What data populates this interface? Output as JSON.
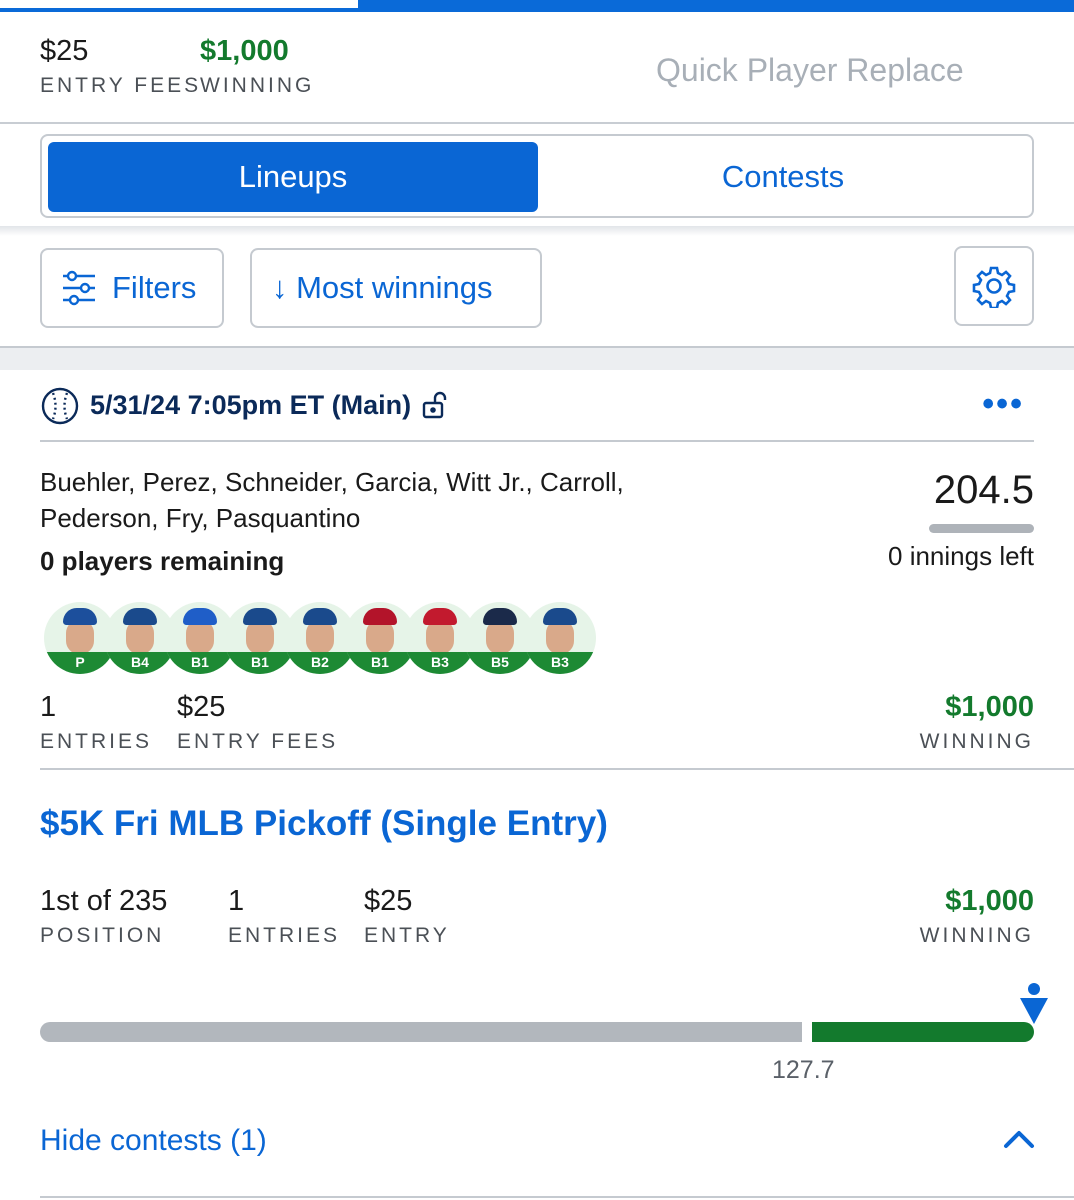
{
  "summary": {
    "entry_fees_value": "$25",
    "entry_fees_label": "ENTRY FEES",
    "winning_value": "$1,000",
    "winning_label": "WINNING",
    "quick_replace": "Quick Player Replace"
  },
  "tabs": {
    "lineups": "Lineups",
    "contests": "Contests",
    "active": "Lineups"
  },
  "toolbar": {
    "filters_label": "Filters",
    "sort_label": "↓ Most winnings",
    "settings_icon": "gear-icon",
    "filters_icon": "sliders-icon"
  },
  "lineup": {
    "date": "5/31/24 7:05pm ET (Main)",
    "sport_icon": "baseball-icon",
    "lock_icon": "unlocked-icon",
    "menu": "•••",
    "players": "Buehler, Perez, Schneider, Garcia, Witt Jr., Carroll, Pederson, Fry, Pasquantino",
    "remaining": "0 players remaining",
    "score": "204.5",
    "innings_left": "0 innings left",
    "positions": [
      "P",
      "B4",
      "B1",
      "B1",
      "B2",
      "B1",
      "B3",
      "B5",
      "B3"
    ],
    "cap_colors": [
      "#1c4f9c",
      "#1a4a8c",
      "#1f5ec8",
      "#1a4a8c",
      "#1a4a8c",
      "#b3142a",
      "#c21a2e",
      "#1b2a4a",
      "#1a4a8c"
    ],
    "entries_value": "1",
    "entries_label": "ENTRIES",
    "fees_value": "$25",
    "fees_label": "ENTRY FEES",
    "winning_value": "$1,000",
    "winning_label": "WINNING"
  },
  "contest": {
    "title": "$5K Fri MLB Pickoff (Single Entry)",
    "position_value": "1st of 235",
    "position_label": "POSITION",
    "entries_value": "1",
    "entries_label": "ENTRIES",
    "entry_value": "$25",
    "entry_label": "ENTRY",
    "winning_value": "$1,000",
    "winning_label": "WINNING",
    "paid_cutoff_points": "127.7",
    "cutoff_fraction": 0.767,
    "user_fraction": 1.0
  },
  "footer": {
    "hide_contests": "Hide contests (1)"
  },
  "colors": {
    "brand_blue": "#0a66d4",
    "money_green": "#137a2d"
  }
}
